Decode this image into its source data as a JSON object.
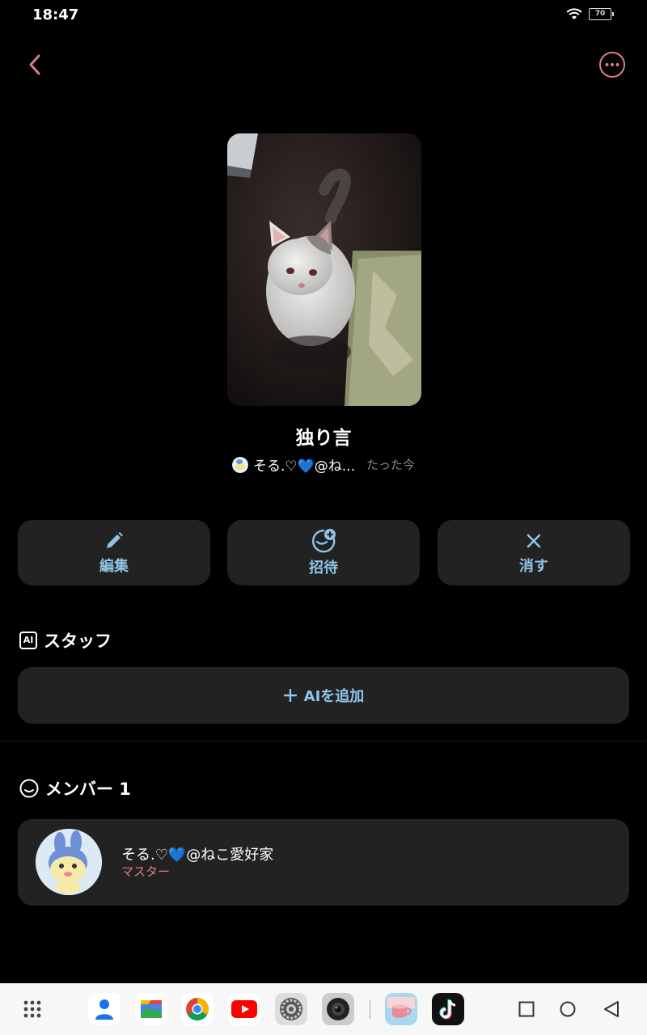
{
  "status_bar": {
    "time": "18:47",
    "battery": "70"
  },
  "room": {
    "title": "独り言",
    "owner_name": "そる.♡💙@ね...",
    "posted_time": "たった今"
  },
  "actions": {
    "edit_label": "編集",
    "invite_label": "招待",
    "delete_label": "消す"
  },
  "staff": {
    "badge": "AI",
    "title": "スタッフ",
    "add_label": "AIを追加"
  },
  "members": {
    "title": "メンバー 1",
    "list": [
      {
        "name": "そる.♡💙@ねこ愛好家",
        "role": "マスター"
      }
    ]
  },
  "colors": {
    "accent_pink": "#e07b86",
    "accent_blue": "#8fc5e6",
    "card_bg": "#222222"
  },
  "taskbar": {
    "apps": [
      "apps-grid-icon",
      "contacts-icon",
      "files-icon",
      "chrome-icon",
      "youtube-icon",
      "settings-icon",
      "camera-icon",
      "cup-app-icon",
      "tiktok-icon"
    ],
    "nav": [
      "recents-icon",
      "home-icon",
      "back-icon"
    ]
  }
}
